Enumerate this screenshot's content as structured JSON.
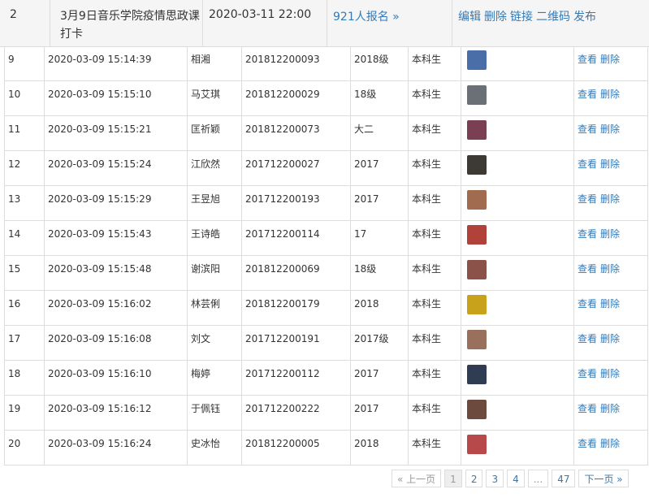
{
  "header_row": {
    "index": "2",
    "title": "3月9日音乐学院疫情思政课打卡",
    "datetime": "2020-03-11 22:00",
    "signup_link": "921人报名 »",
    "actions": [
      "编辑",
      "删除",
      "链接",
      "二维码",
      "发布"
    ]
  },
  "rows": [
    {
      "no": "9",
      "time": "2020-03-09 15:14:39",
      "name": "相湘",
      "student_id": "201812200093",
      "grade": "2018级",
      "level": "本科生",
      "thumb_color": "#4a6fa8"
    },
    {
      "no": "10",
      "time": "2020-03-09 15:15:10",
      "name": "马艾琪",
      "student_id": "201812200029",
      "grade": "18级",
      "level": "本科生",
      "thumb_color": "#6b7077"
    },
    {
      "no": "11",
      "time": "2020-03-09 15:15:21",
      "name": "匡祈颖",
      "student_id": "201812200073",
      "grade": "大二",
      "level": "本科生",
      "thumb_color": "#7a3f52"
    },
    {
      "no": "12",
      "time": "2020-03-09 15:15:24",
      "name": "江欣然",
      "student_id": "201712200027",
      "grade": "2017",
      "level": "本科生",
      "thumb_color": "#3d3a36"
    },
    {
      "no": "13",
      "time": "2020-03-09 15:15:29",
      "name": "王昱旭",
      "student_id": "201712200193",
      "grade": "2017",
      "level": "本科生",
      "thumb_color": "#a06b4e"
    },
    {
      "no": "14",
      "time": "2020-03-09 15:15:43",
      "name": "王诗皓",
      "student_id": "201712200114",
      "grade": "17",
      "level": "本科生",
      "thumb_color": "#b0423a"
    },
    {
      "no": "15",
      "time": "2020-03-09 15:15:48",
      "name": "谢滨阳",
      "student_id": "201812200069",
      "grade": "18级",
      "level": "本科生",
      "thumb_color": "#8a5248"
    },
    {
      "no": "16",
      "time": "2020-03-09 15:16:02",
      "name": "林芸俐",
      "student_id": "201812200179",
      "grade": "2018",
      "level": "本科生",
      "thumb_color": "#c9a21b"
    },
    {
      "no": "17",
      "time": "2020-03-09 15:16:08",
      "name": "刘文",
      "student_id": "201712200191",
      "grade": "2017级",
      "level": "本科生",
      "thumb_color": "#98705c"
    },
    {
      "no": "18",
      "time": "2020-03-09 15:16:10",
      "name": "梅婷",
      "student_id": "201712200112",
      "grade": "2017",
      "level": "本科生",
      "thumb_color": "#2f3c52"
    },
    {
      "no": "19",
      "time": "2020-03-09 15:16:12",
      "name": "于佩钰",
      "student_id": "201712200222",
      "grade": "2017",
      "level": "本科生",
      "thumb_color": "#6d4a3e"
    },
    {
      "no": "20",
      "time": "2020-03-09 15:16:24",
      "name": "史冰怡",
      "student_id": "201812200005",
      "grade": "2018",
      "level": "本科生",
      "thumb_color": "#b8494a"
    }
  ],
  "row_actions": {
    "view": "查看",
    "delete": "删除"
  },
  "pagination": {
    "prev": "« 上一页",
    "pages": [
      "1",
      "2",
      "3",
      "4",
      "...",
      "47"
    ],
    "current": "1",
    "next": "下一页 »"
  }
}
